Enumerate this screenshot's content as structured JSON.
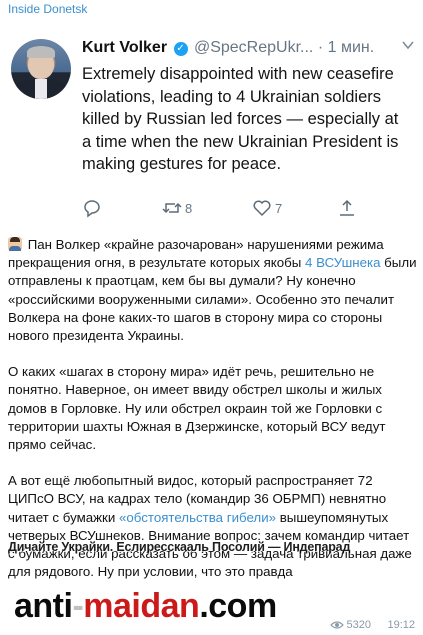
{
  "channel": {
    "name": "Inside Donetsk"
  },
  "tweet": {
    "name": "Kurt Volker",
    "handle": "@SpecRepUkr...",
    "time": "· 1 мин.",
    "text": "Extremely disappointed with new ceasefire violations, leading to 4 Ukrainian soldiers killed by Russian led forces — especially at a time when the new Ukrainian President is making gestures for peace.",
    "retweets": "8",
    "likes": "7"
  },
  "post": {
    "p1_a": " Пан Волкер «крайне разочарован» нарушениями режима прекращения огня, в результате которых якобы ",
    "p1_link": "4 ВСУшнека",
    "p1_b": " были отправлены к праотцам, кем бы вы думали? Ну конечно «российскими вооруженными силами». Особенно это печалит Волкера на фоне каких-то шагов в сторону мира со стороны нового президента Украины.",
    "p2": "О каких «шагах в сторону мира» идёт речь, решительно не понятно. Наверное, он имеет ввиду обстрел школы и жилых домов в Горловке. Ну или обстрел окраин той же Горловки с территории шахты Южная в Дзержинске, который ВСУ ведут прямо сейчас.",
    "p3_a": "А вот ещё любопытный видос, который распространяет 72 ЦИПсО ВСУ, на кадрах тело (командир 36 ОБРМП) невнятно читает с бумажки ",
    "p3_link": "«обстоятельства гибели»",
    "p3_b": " вышеупомянутых четверых ВСУшнеков. Внимание вопрос: зачем командир читает с бумажки, если рассказать об этом — задача тривиальная даже для рядового. Ну при условии, что это правда"
  },
  "overlay": {
    "text": "Дичайте Украйки. Еслиресскааль Посолий — Индепарад"
  },
  "watermark": {
    "part1": "anti",
    "dot": "-",
    "part2": "maidan",
    "part3": ".com"
  },
  "footer": {
    "views": "5320",
    "time": "19:12"
  },
  "colors": {
    "link": "#3a8fcf",
    "twitter_blue": "#1da1f2",
    "watermark_red": "#cc1a1a"
  }
}
